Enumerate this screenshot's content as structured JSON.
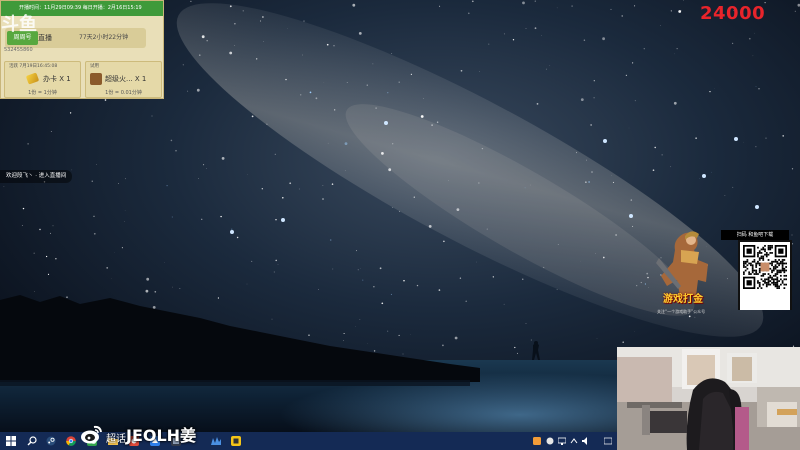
{
  "overlay": {
    "logo": "斗鱼",
    "banner": "开播时间：11月29日09:39 每日开播：2月16日15:19",
    "platform_tag": "周周号",
    "stream_label": "直播",
    "duration": "77天2小时22分钟",
    "streamer_id": "532455860",
    "rewards": [
      {
        "header": "活跃 7月19日16:45:08",
        "name": "办卡 X 1",
        "rate": "1份 = 1分钟"
      },
      {
        "header": "试用",
        "name": "超级火... X 1",
        "rate": "1份 = 0.01分钟"
      }
    ]
  },
  "score": "24000",
  "chat": {
    "welcome": "欢迎段飞丶 · 进入直播间"
  },
  "promo": {
    "qr_title": "扫码 和鱼吧下载",
    "brand": "游戏打金",
    "note": "关注“一个游戏助手”公众号"
  },
  "watermark": {
    "prefix": "超话",
    "handle": "JEOLH姜"
  },
  "colors": {
    "taskbar": "#142a55",
    "score": "#e8242b",
    "overlay_green": "#3f9a3a",
    "overlay_bg": "#e9dfb8"
  }
}
